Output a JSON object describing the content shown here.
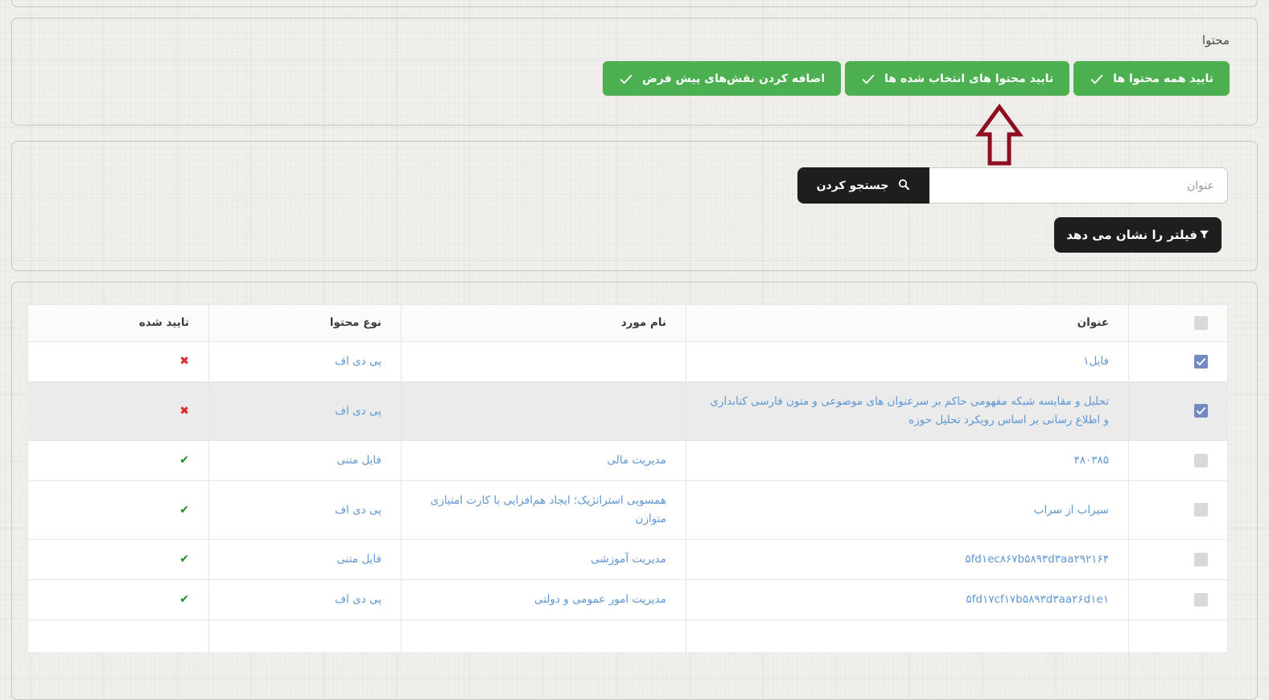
{
  "content_panel": {
    "heading": "محتوا",
    "buttons": [
      {
        "id": "approve-all",
        "label": "تایید همه محتوا ها",
        "icon": "check-icon"
      },
      {
        "id": "approve-selected",
        "label": "تایید محتوا های انتخاب شده ها",
        "icon": "check-icon"
      },
      {
        "id": "add-default-roles",
        "label": "اضافه کردن نقش‌های پیش فرض",
        "icon": "check-icon"
      }
    ]
  },
  "annotation_arrow": {
    "shape": "up-arrow-outline",
    "color": "#8e0e20",
    "points_at": "تایید محتوا های انتخاب شده ها"
  },
  "search_panel": {
    "title_input": {
      "placeholder": "عنوان",
      "value": ""
    },
    "search_button": {
      "label": "جستجو کردن",
      "icon": "search-icon"
    },
    "filter_button": {
      "label": "فیلتر را نشان می دهد",
      "icon": "filter-icon"
    }
  },
  "table": {
    "headers": {
      "title": "عنوان",
      "item_name": "نام مورد",
      "content_type": "نوع محتوا",
      "approved": "تایید شده"
    },
    "select_all_checked": false,
    "approved_icons": {
      "approved": "✔",
      "not_approved": "✖"
    },
    "rows": [
      {
        "checked": true,
        "highlighted": false,
        "title": "فایل۱",
        "item_name": "",
        "content_type": "پی دی اف",
        "approved": false
      },
      {
        "checked": true,
        "highlighted": true,
        "title": "تحلیل و مقایسه شبکه مفهومی حاکم بر سرعنوان های موضوعی و متون فارسی کتابداری و اطلاع رسانی بر اساس رویکرد تحلیل حوزه",
        "item_name": "",
        "content_type": "پی دی اف",
        "approved": false
      },
      {
        "checked": false,
        "highlighted": false,
        "title": "۴۸۰۳۸۵",
        "item_name": "مدیریت مالی",
        "content_type": "فایل متنی",
        "approved": true
      },
      {
        "checked": false,
        "highlighted": false,
        "title": "سیراب از سراب",
        "item_name": "همسویی استراتژیک؛ ایجاد هم‌افزایی با کارت امتیازی متوازن",
        "content_type": "پی دی اف",
        "approved": true
      },
      {
        "checked": false,
        "highlighted": false,
        "title": "۵fd۱ec۸۶۷b۵۸۹۳d۳aa۲۹۲۱۶۴",
        "item_name": "مدیریت آموزشی",
        "content_type": "فایل متنی",
        "approved": true
      },
      {
        "checked": false,
        "highlighted": false,
        "title": "۵fd۱۷cf۱۷b۵۸۹۳d۳aa۲۶d۱e۱",
        "item_name": "مدیریت امور عمومی و دولتی",
        "content_type": "پی دی اف",
        "approved": true
      }
    ]
  },
  "colors": {
    "accent_green": "#4cb050",
    "dark_button": "#1e1e1e",
    "link_blue": "#5e97d3",
    "check_green": "#1c8a1c",
    "cross_red": "#d92b2b",
    "checkbox_blue": "#7289c1",
    "arrow_red": "#8e0e20"
  }
}
